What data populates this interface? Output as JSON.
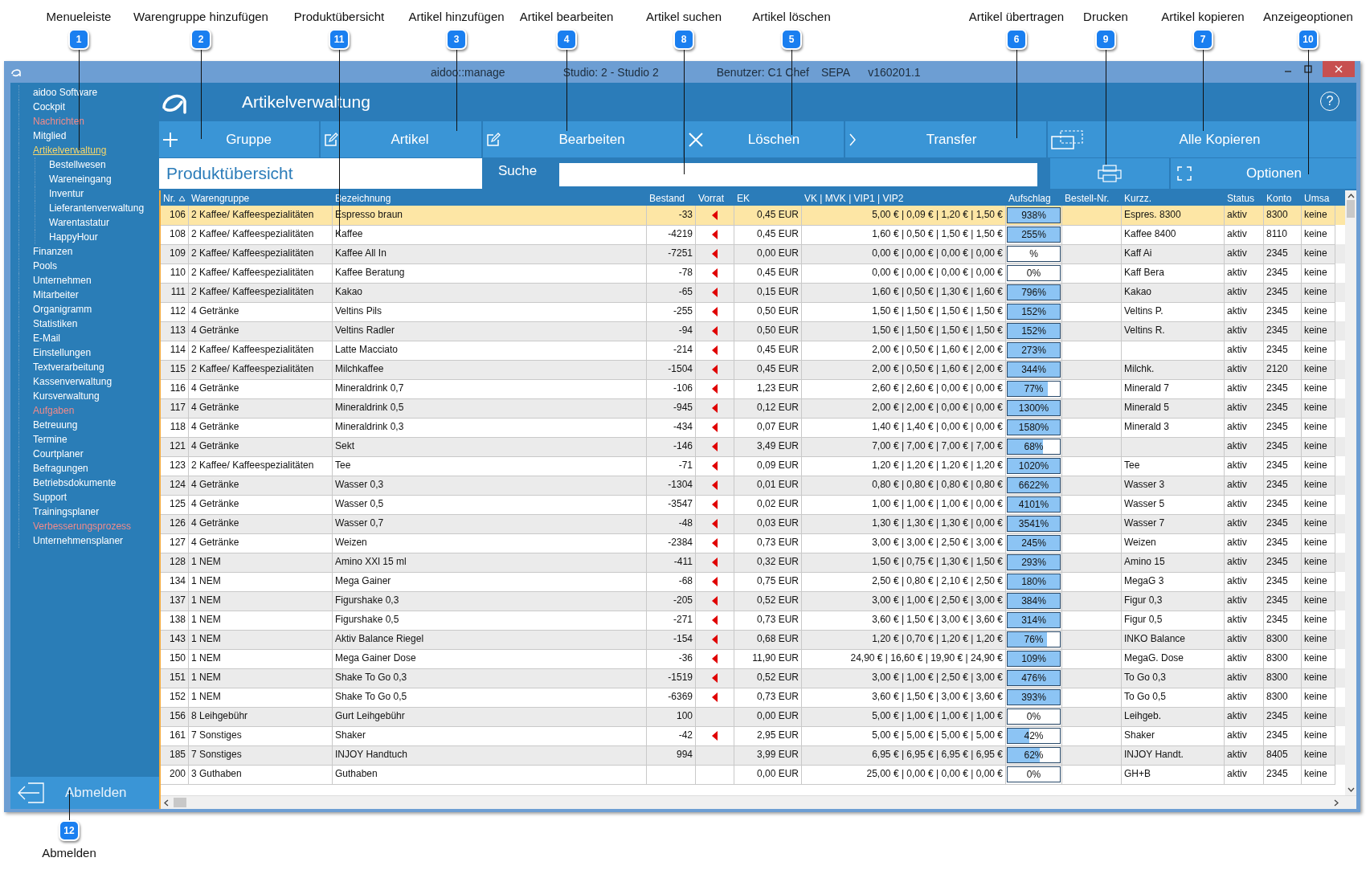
{
  "callouts": [
    {
      "number": "1",
      "label": "Menueleiste",
      "kind": "top"
    },
    {
      "number": "2",
      "label": "Warengruppe hinzufügen",
      "kind": "top"
    },
    {
      "number": "11",
      "label": "Produktübersicht",
      "kind": "top"
    },
    {
      "number": "3",
      "label": "Artikel hinzufügen",
      "kind": "top"
    },
    {
      "number": "4",
      "label": "Artikel bearbeiten",
      "kind": "top"
    },
    {
      "number": "8",
      "label": "Artikel suchen",
      "kind": "top"
    },
    {
      "number": "5",
      "label": "Artikel löschen",
      "kind": "top"
    },
    {
      "number": "6",
      "label": "Artikel übertragen",
      "kind": "top"
    },
    {
      "number": "9",
      "label": "Drucken",
      "kind": "top"
    },
    {
      "number": "7",
      "label": "Artikel kopieren",
      "kind": "top"
    },
    {
      "number": "10",
      "label": "Anzeigeoptionen",
      "kind": "top"
    },
    {
      "number": "12",
      "label": "Abmelden",
      "kind": "bottom"
    }
  ],
  "window": {
    "title_parts": [
      "aidoo::manage",
      "Studio: 2 - Studio 2",
      "Benutzer: C1 Chef",
      "SEPA",
      "v160201.1"
    ]
  },
  "sidebar": {
    "items": [
      {
        "label": "aidoo Software",
        "alert": false,
        "selected": false
      },
      {
        "label": "Cockpit",
        "alert": false,
        "selected": false
      },
      {
        "label": "Nachrichten",
        "alert": true,
        "selected": false
      },
      {
        "label": "Mitglied",
        "alert": false,
        "selected": false
      },
      {
        "label": "Artikelverwaltung",
        "alert": false,
        "selected": true,
        "children": [
          {
            "label": "Bestellwesen",
            "alert": false,
            "selected": false
          },
          {
            "label": "Wareneingang",
            "alert": false,
            "selected": false
          },
          {
            "label": "Inventur",
            "alert": false,
            "selected": false
          },
          {
            "label": "Lieferantenverwaltung",
            "alert": false,
            "selected": false
          },
          {
            "label": "Warentastatur",
            "alert": false,
            "selected": false
          },
          {
            "label": "HappyHour",
            "alert": false,
            "selected": false
          }
        ]
      },
      {
        "label": "Finanzen",
        "alert": false,
        "selected": false
      },
      {
        "label": "Pools",
        "alert": false,
        "selected": false
      },
      {
        "label": "Unternehmen",
        "alert": false,
        "selected": false
      },
      {
        "label": "Mitarbeiter",
        "alert": false,
        "selected": false
      },
      {
        "label": "Organigramm",
        "alert": false,
        "selected": false
      },
      {
        "label": "Statistiken",
        "alert": false,
        "selected": false
      },
      {
        "label": "E-Mail",
        "alert": false,
        "selected": false
      },
      {
        "label": "Einstellungen",
        "alert": false,
        "selected": false
      },
      {
        "label": "Textverarbeitung",
        "alert": false,
        "selected": false
      },
      {
        "label": "Kassenverwaltung",
        "alert": false,
        "selected": false
      },
      {
        "label": "Kursverwaltung",
        "alert": false,
        "selected": false
      },
      {
        "label": "Aufgaben",
        "alert": true,
        "selected": false
      },
      {
        "label": "Betreuung",
        "alert": false,
        "selected": false
      },
      {
        "label": "Termine",
        "alert": false,
        "selected": false
      },
      {
        "label": "Courtplaner",
        "alert": false,
        "selected": false
      },
      {
        "label": "Befragungen",
        "alert": false,
        "selected": false
      },
      {
        "label": "Betriebsdokumente",
        "alert": false,
        "selected": false
      },
      {
        "label": "Support",
        "alert": false,
        "selected": false
      },
      {
        "label": "Trainingsplaner",
        "alert": false,
        "selected": false
      },
      {
        "label": "Verbesserungsprozess",
        "alert": true,
        "selected": false
      },
      {
        "label": "Unternehmensplaner",
        "alert": false,
        "selected": false
      }
    ],
    "logout": "Abmelden"
  },
  "header": {
    "title": "Artikelverwaltung",
    "help": "?"
  },
  "toolbar": [
    {
      "label": "Gruppe",
      "kind": "plus"
    },
    {
      "label": "Artikel",
      "kind": "edit"
    },
    {
      "label": "Bearbeiten",
      "kind": "edit"
    },
    {
      "label": "Löschen",
      "kind": "delete"
    },
    {
      "label": "Transfer",
      "kind": "chevron"
    },
    {
      "label": "Alle Kopieren",
      "kind": "copy"
    }
  ],
  "subbar": {
    "title": "Produktübersicht",
    "search_label": "Suche",
    "options_label": "Optionen"
  },
  "table": {
    "columns": [
      {
        "label": "Nr.",
        "sorted": true
      },
      {
        "label": "Warengruppe",
        "sorted": false
      },
      {
        "label": "Bezeichnung",
        "sorted": false
      },
      {
        "label": "Bestand",
        "sorted": false
      },
      {
        "label": "Vorrat",
        "sorted": false
      },
      {
        "label": "EK",
        "sorted": false
      },
      {
        "label": "VK | MVK | VIP1 | VIP2",
        "sorted": false
      },
      {
        "label": "Aufschlag",
        "sorted": false
      },
      {
        "label": "Bestell-Nr.",
        "sorted": false
      },
      {
        "label": "Kurzz.",
        "sorted": false
      },
      {
        "label": "Status",
        "sorted": false
      },
      {
        "label": "Konto",
        "sorted": false
      },
      {
        "label": "Umsa",
        "sorted": false
      }
    ],
    "rows": [
      {
        "nr": "106",
        "group": "2 Kaffee/ Kaffeespezialitäten",
        "name": "Espresso braun",
        "stock": "-33",
        "stock_alert": true,
        "ek": "0,45 EUR",
        "prices": "5,00 € | 0,09 € | 1,20 € | 1,50 €",
        "markup": {
          "text": "938%",
          "level": 1
        },
        "short": "Espres. 8300",
        "status": "aktiv",
        "account": "8300",
        "column_13": "keine",
        "selected": true
      },
      {
        "nr": "108",
        "group": "2 Kaffee/ Kaffeespezialitäten",
        "name": "Kaffee",
        "stock": "-4219",
        "stock_alert": true,
        "ek": "0,45 EUR",
        "prices": "1,60 € | 0,50 € | 1,50 € | 1,50 €",
        "markup": {
          "text": "255%",
          "level": 1
        },
        "short": "Kaffee 8400",
        "status": "aktiv",
        "account": "8110",
        "column_13": "keine",
        "selected": false
      },
      {
        "nr": "109",
        "group": "2 Kaffee/ Kaffeespezialitäten",
        "name": "Kaffee All In",
        "stock": "-7251",
        "stock_alert": true,
        "ek": "0,00 EUR",
        "prices": "0,00 € | 0,00 € | 0,00 € | 0,00 €",
        "markup": {
          "text": "%",
          "level": 0
        },
        "short": "Kaff Ai",
        "status": "aktiv",
        "account": "2345",
        "column_13": "keine",
        "selected": false
      },
      {
        "nr": "110",
        "group": "2 Kaffee/ Kaffeespezialitäten",
        "name": "Kaffee Beratung",
        "stock": "-78",
        "stock_alert": true,
        "ek": "0,45 EUR",
        "prices": "0,00 € | 0,00 € | 0,00 € | 0,00 €",
        "markup": {
          "text": "0%",
          "level": 0
        },
        "short": "Kaff Bera",
        "status": "aktiv",
        "account": "2345",
        "column_13": "keine",
        "selected": false
      },
      {
        "nr": "111",
        "group": "2 Kaffee/ Kaffeespezialitäten",
        "name": "Kakao",
        "stock": "-65",
        "stock_alert": true,
        "ek": "0,15 EUR",
        "prices": "1,60 € | 0,50 € | 1,30 € | 1,60 €",
        "markup": {
          "text": "796%",
          "level": 1
        },
        "short": "Kakao",
        "status": "aktiv",
        "account": "2345",
        "column_13": "keine",
        "selected": false
      },
      {
        "nr": "112",
        "group": "4 Getränke",
        "name": "Veltins Pils",
        "stock": "-255",
        "stock_alert": true,
        "ek": "0,50 EUR",
        "prices": "1,50 € | 1,50 € | 1,50 € | 1,50 €",
        "markup": {
          "text": "152%",
          "level": 1
        },
        "short": "Veltins P.",
        "status": "aktiv",
        "account": "2345",
        "column_13": "keine",
        "selected": false
      },
      {
        "nr": "113",
        "group": "4 Getränke",
        "name": "Veltins Radler",
        "stock": "-94",
        "stock_alert": true,
        "ek": "0,50 EUR",
        "prices": "1,50 € | 1,50 € | 1,50 € | 1,50 €",
        "markup": {
          "text": "152%",
          "level": 1
        },
        "short": "Veltins R.",
        "status": "aktiv",
        "account": "2345",
        "column_13": "keine",
        "selected": false
      },
      {
        "nr": "114",
        "group": "2 Kaffee/ Kaffeespezialitäten",
        "name": "Latte Macciato",
        "stock": "-214",
        "stock_alert": true,
        "ek": "0,45 EUR",
        "prices": "2,00 € | 0,50 € | 1,60 € | 2,00 €",
        "markup": {
          "text": "273%",
          "level": 1
        },
        "status": "aktiv",
        "account": "2345",
        "column_13": "keine",
        "selected": false
      },
      {
        "nr": "115",
        "group": "2 Kaffee/ Kaffeespezialitäten",
        "name": "Milchkaffee",
        "stock": "-1504",
        "stock_alert": true,
        "ek": "0,45 EUR",
        "prices": "2,00 € | 0,50 € | 1,60 € | 2,00 €",
        "markup": {
          "text": "344%",
          "level": 1
        },
        "short": "Milchk.",
        "status": "aktiv",
        "account": "2120",
        "column_13": "keine",
        "selected": false
      },
      {
        "nr": "116",
        "group": "4 Getränke",
        "name": "Mineraldrink 0,7",
        "stock": "-106",
        "stock_alert": true,
        "ek": "1,23 EUR",
        "prices": "2,60 € | 2,60 € | 0,00 € | 0,00 €",
        "markup": {
          "text": "77%",
          "level": 0.77
        },
        "short": "Minerald 7",
        "status": "aktiv",
        "account": "2345",
        "column_13": "keine",
        "selected": false
      },
      {
        "nr": "117",
        "group": "4 Getränke",
        "name": "Mineraldrink 0,5",
        "stock": "-945",
        "stock_alert": true,
        "ek": "0,12 EUR",
        "prices": "2,00 € | 2,00 € | 0,00 € | 0,00 €",
        "markup": {
          "text": "1300%",
          "level": 1
        },
        "short": "Minerald 5",
        "status": "aktiv",
        "account": "2345",
        "column_13": "keine",
        "selected": false
      },
      {
        "nr": "118",
        "group": "4 Getränke",
        "name": "Mineraldrink 0,3",
        "stock": "-434",
        "stock_alert": true,
        "ek": "0,07 EUR",
        "prices": "1,40 € | 1,40 € | 0,00 € | 0,00 €",
        "markup": {
          "text": "1580%",
          "level": 1
        },
        "short": "Minerald 3",
        "status": "aktiv",
        "account": "2345",
        "column_13": "keine",
        "selected": false
      },
      {
        "nr": "121",
        "group": "4 Getränke",
        "name": "Sekt",
        "stock": "-146",
        "stock_alert": true,
        "ek": "3,49 EUR",
        "prices": "7,00 € | 7,00 € | 7,00 € | 7,00 €",
        "markup": {
          "text": "68%",
          "level": 0.68
        },
        "status": "aktiv",
        "account": "2345",
        "column_13": "keine",
        "selected": false
      },
      {
        "nr": "123",
        "group": "2 Kaffee/ Kaffeespezialitäten",
        "name": "Tee",
        "stock": "-71",
        "stock_alert": true,
        "ek": "0,09 EUR",
        "prices": "1,20 € | 1,20 € | 1,20 € | 1,20 €",
        "markup": {
          "text": "1020%",
          "level": 1
        },
        "short": "Tee",
        "status": "aktiv",
        "account": "2345",
        "column_13": "keine",
        "selected": false
      },
      {
        "nr": "124",
        "group": "4 Getränke",
        "name": "Wasser 0,3",
        "stock": "-1304",
        "stock_alert": true,
        "ek": "0,01 EUR",
        "prices": "0,80 € | 0,80 € | 0,80 € | 0,80 €",
        "markup": {
          "text": "6622%",
          "level": 1
        },
        "short": "Wasser 3",
        "status": "aktiv",
        "account": "2345",
        "column_13": "keine",
        "selected": false
      },
      {
        "nr": "125",
        "group": "4 Getränke",
        "name": "Wasser 0,5",
        "stock": "-3547",
        "stock_alert": true,
        "ek": "0,02 EUR",
        "prices": "1,00 € | 1,00 € | 1,00 € | 0,00 €",
        "markup": {
          "text": "4101%",
          "level": 1
        },
        "short": "Wasser 5",
        "status": "aktiv",
        "account": "2345",
        "column_13": "keine",
        "selected": false
      },
      {
        "nr": "126",
        "group": "4 Getränke",
        "name": "Wasser 0,7",
        "stock": "-48",
        "stock_alert": true,
        "ek": "0,03 EUR",
        "prices": "1,30 € | 1,30 € | 1,30 € | 0,00 €",
        "markup": {
          "text": "3541%",
          "level": 1
        },
        "short": "Wasser 7",
        "status": "aktiv",
        "account": "2345",
        "column_13": "keine",
        "selected": false
      },
      {
        "nr": "127",
        "group": "4 Getränke",
        "name": "Weizen",
        "stock": "-2384",
        "stock_alert": true,
        "ek": "0,73 EUR",
        "prices": "3,00 € | 3,00 € | 2,50 € | 3,00 €",
        "markup": {
          "text": "245%",
          "level": 1
        },
        "short": "Weizen",
        "status": "aktiv",
        "account": "2345",
        "column_13": "keine",
        "selected": false
      },
      {
        "nr": "128",
        "group": "1 NEM",
        "name": "Amino XXl 15 ml",
        "stock": "-411",
        "stock_alert": true,
        "ek": "0,32 EUR",
        "prices": "1,50 € | 0,75 € | 1,30 € | 1,50 €",
        "markup": {
          "text": "293%",
          "level": 1
        },
        "short": "Amino 15",
        "status": "aktiv",
        "account": "2345",
        "column_13": "keine",
        "selected": false
      },
      {
        "nr": "134",
        "group": "1 NEM",
        "name": "Mega Gainer",
        "stock": "-68",
        "stock_alert": true,
        "ek": "0,75 EUR",
        "prices": "2,50 € | 0,80 € | 2,10 € | 2,50 €",
        "markup": {
          "text": "180%",
          "level": 1
        },
        "short": "MegaG 3",
        "status": "aktiv",
        "account": "2345",
        "column_13": "keine",
        "selected": false
      },
      {
        "nr": "137",
        "group": "1 NEM",
        "name": "Figurshake 0,3",
        "stock": "-205",
        "stock_alert": true,
        "ek": "0,52 EUR",
        "prices": "3,00 € | 1,00 € | 2,50 € | 3,00 €",
        "markup": {
          "text": "384%",
          "level": 1
        },
        "short": "Figur 0,3",
        "status": "aktiv",
        "account": "2345",
        "column_13": "keine",
        "selected": false
      },
      {
        "nr": "138",
        "group": "1 NEM",
        "name": "Figurshake 0,5",
        "stock": "-271",
        "stock_alert": true,
        "ek": "0,73 EUR",
        "prices": "3,60 € | 1,50 € | 3,00 € | 3,60 €",
        "markup": {
          "text": "314%",
          "level": 1
        },
        "short": "Figur 0,5",
        "status": "aktiv",
        "account": "2345",
        "column_13": "keine",
        "selected": false
      },
      {
        "nr": "143",
        "group": "1 NEM",
        "name": "Aktiv Balance Riegel",
        "stock": "-154",
        "stock_alert": true,
        "ek": "0,68 EUR",
        "prices": "1,20 € | 0,70 € | 1,20 € | 1,20 €",
        "markup": {
          "text": "76%",
          "level": 0.76
        },
        "short": "INKO Balance",
        "status": "aktiv",
        "account": "8300",
        "column_13": "keine",
        "selected": false
      },
      {
        "nr": "150",
        "group": "1 NEM",
        "name": "Mega Gainer Dose",
        "stock": "-36",
        "stock_alert": true,
        "ek": "11,90 EUR",
        "prices": "24,90 € | 16,60 € | 19,90 € | 24,90 €",
        "markup": {
          "text": "109%",
          "level": 1
        },
        "short": "MegaG. Dose",
        "status": "aktiv",
        "account": "8300",
        "column_13": "keine",
        "selected": false
      },
      {
        "nr": "151",
        "group": "1 NEM",
        "name": "Shake To Go 0,3",
        "stock": "-1519",
        "stock_alert": true,
        "ek": "0,52 EUR",
        "prices": "3,00 € | 1,00 € | 2,50 € | 3,00 €",
        "markup": {
          "text": "476%",
          "level": 1
        },
        "short": "To Go 0,3",
        "status": "aktiv",
        "account": "8300",
        "column_13": "keine",
        "selected": false
      },
      {
        "nr": "152",
        "group": "1 NEM",
        "name": "Shake To Go 0,5",
        "stock": "-6369",
        "stock_alert": true,
        "ek": "0,73 EUR",
        "prices": "3,60 € | 1,50 € | 3,00 € | 3,60 €",
        "markup": {
          "text": "393%",
          "level": 1
        },
        "short": "To Go 0,5",
        "status": "aktiv",
        "account": "8300",
        "column_13": "keine",
        "selected": false
      },
      {
        "nr": "156",
        "group": "8 Leihgebühr",
        "name": "Gurt Leihgebühr",
        "stock": "100",
        "stock_alert": false,
        "ek": "0,00 EUR",
        "prices": "5,00 € | 1,00 € | 1,00 € | 1,00 €",
        "markup": {
          "text": "0%",
          "level": 0
        },
        "short": "Leihgeb.",
        "status": "aktiv",
        "account": "2345",
        "column_13": "keine",
        "selected": false
      },
      {
        "nr": "161",
        "group": "7 Sonstiges",
        "name": "Shaker",
        "stock": "-42",
        "stock_alert": true,
        "ek": "2,95 EUR",
        "prices": "5,00 € | 5,00 € | 5,00 € | 5,00 €",
        "markup": {
          "text": "42%",
          "level": 0.42
        },
        "short": "Shaker",
        "status": "aktiv",
        "account": "2345",
        "column_13": "keine",
        "selected": false
      },
      {
        "nr": "185",
        "group": "7 Sonstiges",
        "name": "INJOY Handtuch",
        "stock": "994",
        "stock_alert": false,
        "ek": "3,99 EUR",
        "prices": "6,95 € | 6,95 € | 6,95 € | 6,95 €",
        "markup": {
          "text": "62%",
          "level": 0.62
        },
        "short": "INJOY Handt.",
        "status": "aktiv",
        "account": "8405",
        "column_13": "keine",
        "selected": false
      },
      {
        "nr": "200",
        "group": "3 Guthaben",
        "name": "Guthaben",
        "stock_alert": false,
        "ek": "0,00 EUR",
        "prices": "25,00 € | 0,00 € | 0,00 € | 0,00 €",
        "markup": {
          "text": "0%",
          "level": 0
        },
        "short": "GH+B",
        "status": "aktiv",
        "account": "2345",
        "column_13": "keine",
        "selected": false
      }
    ]
  }
}
